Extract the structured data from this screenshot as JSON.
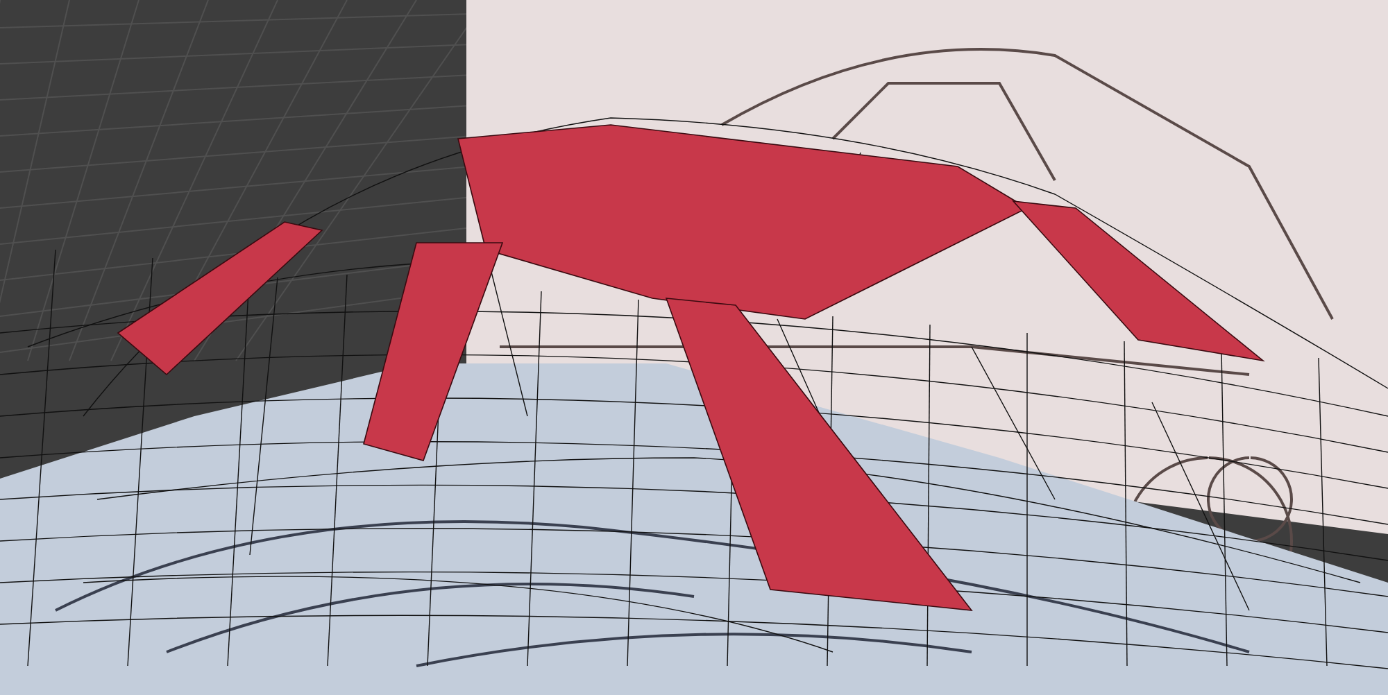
{
  "viewport": {
    "grid": true
  },
  "reference_images": [
    {
      "kind": "side"
    },
    {
      "kind": "top"
    }
  ],
  "mesh": {
    "faces_selected": true,
    "wireframe": true
  }
}
